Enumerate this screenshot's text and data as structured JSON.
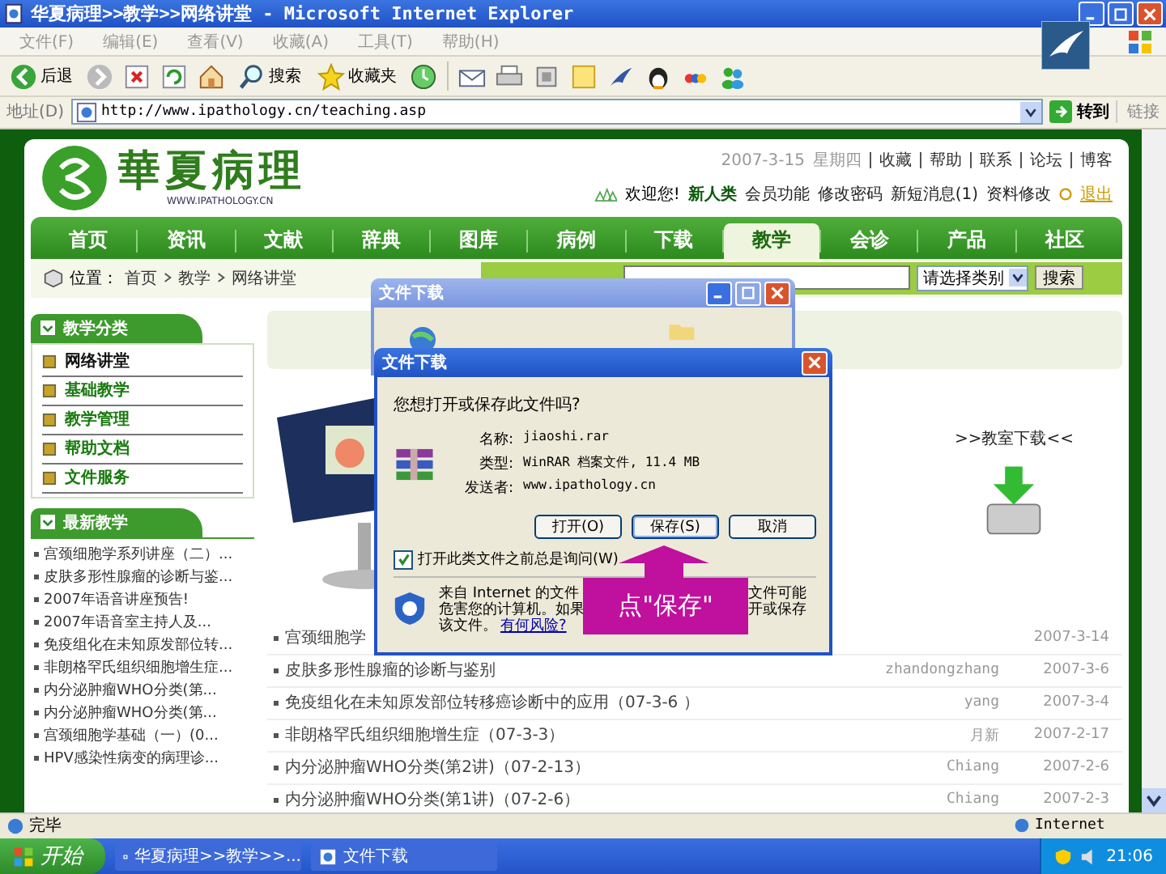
{
  "window": {
    "title": "华夏病理>>教学>>网络讲堂 - Microsoft Internet Explorer"
  },
  "menu": [
    "文件(F)",
    "编辑(E)",
    "查看(V)",
    "收藏(A)",
    "工具(T)",
    "帮助(H)"
  ],
  "toolbar": {
    "back": "后退",
    "search": "搜索",
    "favorites": "收藏夹"
  },
  "address": {
    "label": "地址(D)",
    "url": "http://www.ipathology.cn/teaching.asp",
    "go": "转到",
    "links": "链接"
  },
  "site": {
    "logo_text": "華夏病理",
    "logo_url": "WWW.IPATHOLOGY.CN",
    "date": "2007-3-15",
    "weekday": "星期四",
    "top_links": [
      "收藏",
      "帮助",
      "联系",
      "论坛",
      "博客"
    ],
    "welcome": "欢迎您!",
    "user": "新人类",
    "user_links": [
      "会员功能",
      "修改密码",
      "新短消息(1)",
      "资料修改"
    ],
    "logout": "退出"
  },
  "nav": [
    {
      "label": "首页",
      "selected": false
    },
    {
      "label": "资讯",
      "selected": false
    },
    {
      "label": "文献",
      "selected": false
    },
    {
      "label": "辞典",
      "selected": false
    },
    {
      "label": "图库",
      "selected": false
    },
    {
      "label": "病例",
      "selected": false
    },
    {
      "label": "下载",
      "selected": false
    },
    {
      "label": "教学",
      "selected": true
    },
    {
      "label": "会诊",
      "selected": false
    },
    {
      "label": "产品",
      "selected": false
    },
    {
      "label": "社区",
      "selected": false
    }
  ],
  "breadcrumb": {
    "label": "位置：",
    "path": [
      "首页",
      "教学",
      "网络讲堂"
    ]
  },
  "search": {
    "category": "请选择类别",
    "button": "搜索"
  },
  "sidebar": {
    "categories": {
      "title": "教学分类",
      "items": [
        {
          "label": "网络讲堂",
          "selected": true
        },
        {
          "label": "基础教学",
          "selected": false
        },
        {
          "label": "教学管理",
          "selected": false
        },
        {
          "label": "帮助文档",
          "selected": false
        },
        {
          "label": "文件服务",
          "selected": false
        }
      ]
    },
    "latest": {
      "title": "最新教学",
      "items": [
        "宫颈细胞学系列讲座（二）...",
        "皮肤多形性腺瘤的诊断与鉴...",
        "2007年语音讲座预告!",
        "2007年语音室主持人及...",
        "免疫组化在未知原发部位转...",
        "非朗格罕氏组织细胞增生症...",
        "内分泌肿瘤WHO分类(第...",
        "内分泌肿瘤WHO分类(第...",
        "宫颈细胞学基础（一）(0...",
        "HPV感染性病变的病理诊..."
      ]
    }
  },
  "download_label": ">>教室下载<<",
  "list": [
    {
      "title": "宫颈细胞学",
      "date": "2007-3-14"
    },
    {
      "title": "皮肤多形性腺瘤的诊断与鉴别",
      "author": "zhandongzhang",
      "date": "2007-3-6"
    },
    {
      "title": "免疫组化在未知原发部位转移癌诊断中的应用（07-3-6 ）",
      "author": "yang",
      "date": "2007-3-4"
    },
    {
      "title": "非朗格罕氏组织细胞增生症（07-3-3）",
      "author": "月新",
      "date": "2007-2-17"
    },
    {
      "title": "内分泌肿瘤WHO分类(第2讲)（07-2-13）",
      "author": "Chiang",
      "date": "2007-2-6"
    },
    {
      "title": "内分泌肿瘤WHO分类(第1讲)（07-2-6）",
      "author": "Chiang",
      "date": "2007-2-3"
    }
  ],
  "dialog_back": {
    "title": "文件下载"
  },
  "dialog": {
    "title": "文件下载",
    "question": "您想打开或保存此文件吗?",
    "fields": [
      {
        "label": "名称:",
        "value": "jiaoshi.rar"
      },
      {
        "label": "类型:",
        "value": "WinRAR 档案文件, 11.4 MB"
      },
      {
        "label": "发送者:",
        "value": "www.ipathology.cn"
      }
    ],
    "buttons": [
      "打开(O)",
      "保存(S)",
      "取消"
    ],
    "checkbox": {
      "label": "打开此类文件之前总是询问(W)",
      "checked": true
    },
    "warning_left": [
      "来自 Internet 的文件",
      "危害您的计算机。如果",
      "该文件。"
    ],
    "warning_link": "有何风险?",
    "warning_right": [
      "文件可能",
      "开或保存"
    ]
  },
  "callout": "点\"保存\"",
  "status_bar": {
    "text": "完毕",
    "zone": "Internet"
  },
  "taskbar": {
    "start": "开始",
    "tasks": [
      "华夏病理>>教学>>...",
      "文件下载"
    ],
    "clock": "21:06"
  }
}
